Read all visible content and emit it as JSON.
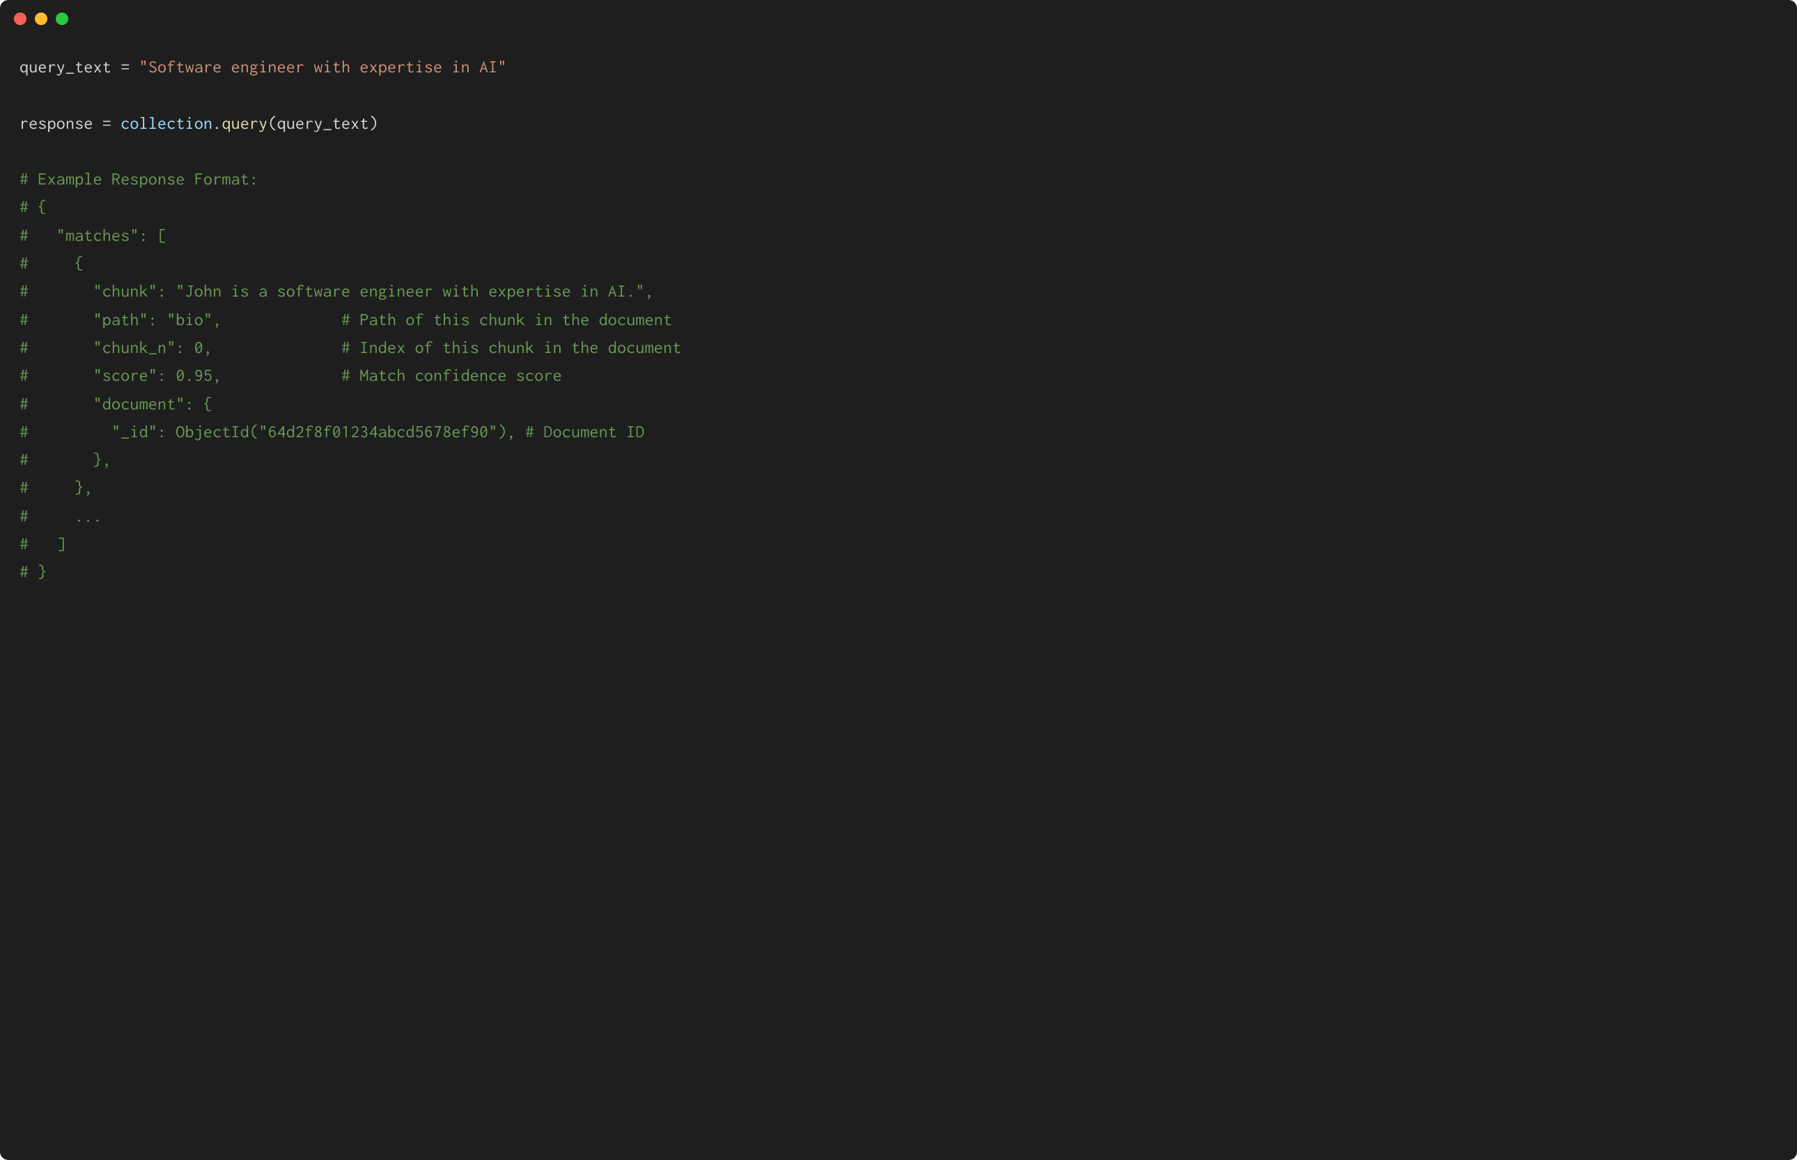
{
  "colors": {
    "bg": "#1e1e1e",
    "red": "#ff5f56",
    "yellow": "#ffbd2e",
    "green": "#27c93f",
    "string": "#ce9178",
    "identifier": "#9cdcfe",
    "method": "#dcdcaa",
    "comment": "#6a9955",
    "default": "#d4d4d4"
  },
  "code": {
    "line1": {
      "var": "query_text",
      "eq": " = ",
      "str": "\"Software engineer with expertise in AI\""
    },
    "line2": {
      "var": "response",
      "eq": " = ",
      "obj": "collection",
      "dot": ".",
      "method": "query",
      "open": "(",
      "arg": "query_text",
      "close": ")"
    },
    "comments": {
      "c1": "# Example Response Format:",
      "c2": "# {",
      "c3": "#   \"matches\": [",
      "c4": "#     {",
      "c5": "#       \"chunk\": \"John is a software engineer with expertise in AI.\",",
      "c6": "#       \"path\": \"bio\",             # Path of this chunk in the document",
      "c7": "#       \"chunk_n\": 0,              # Index of this chunk in the document",
      "c8": "#       \"score\": 0.95,             # Match confidence score",
      "c9": "#       \"document\": {",
      "c10": "#         \"_id\": ObjectId(\"64d2f8f01234abcd5678ef90\"), # Document ID",
      "c11": "#       },",
      "c12": "#     },",
      "c13": "#     ...",
      "c14": "#   ]",
      "c15": "# }"
    }
  }
}
